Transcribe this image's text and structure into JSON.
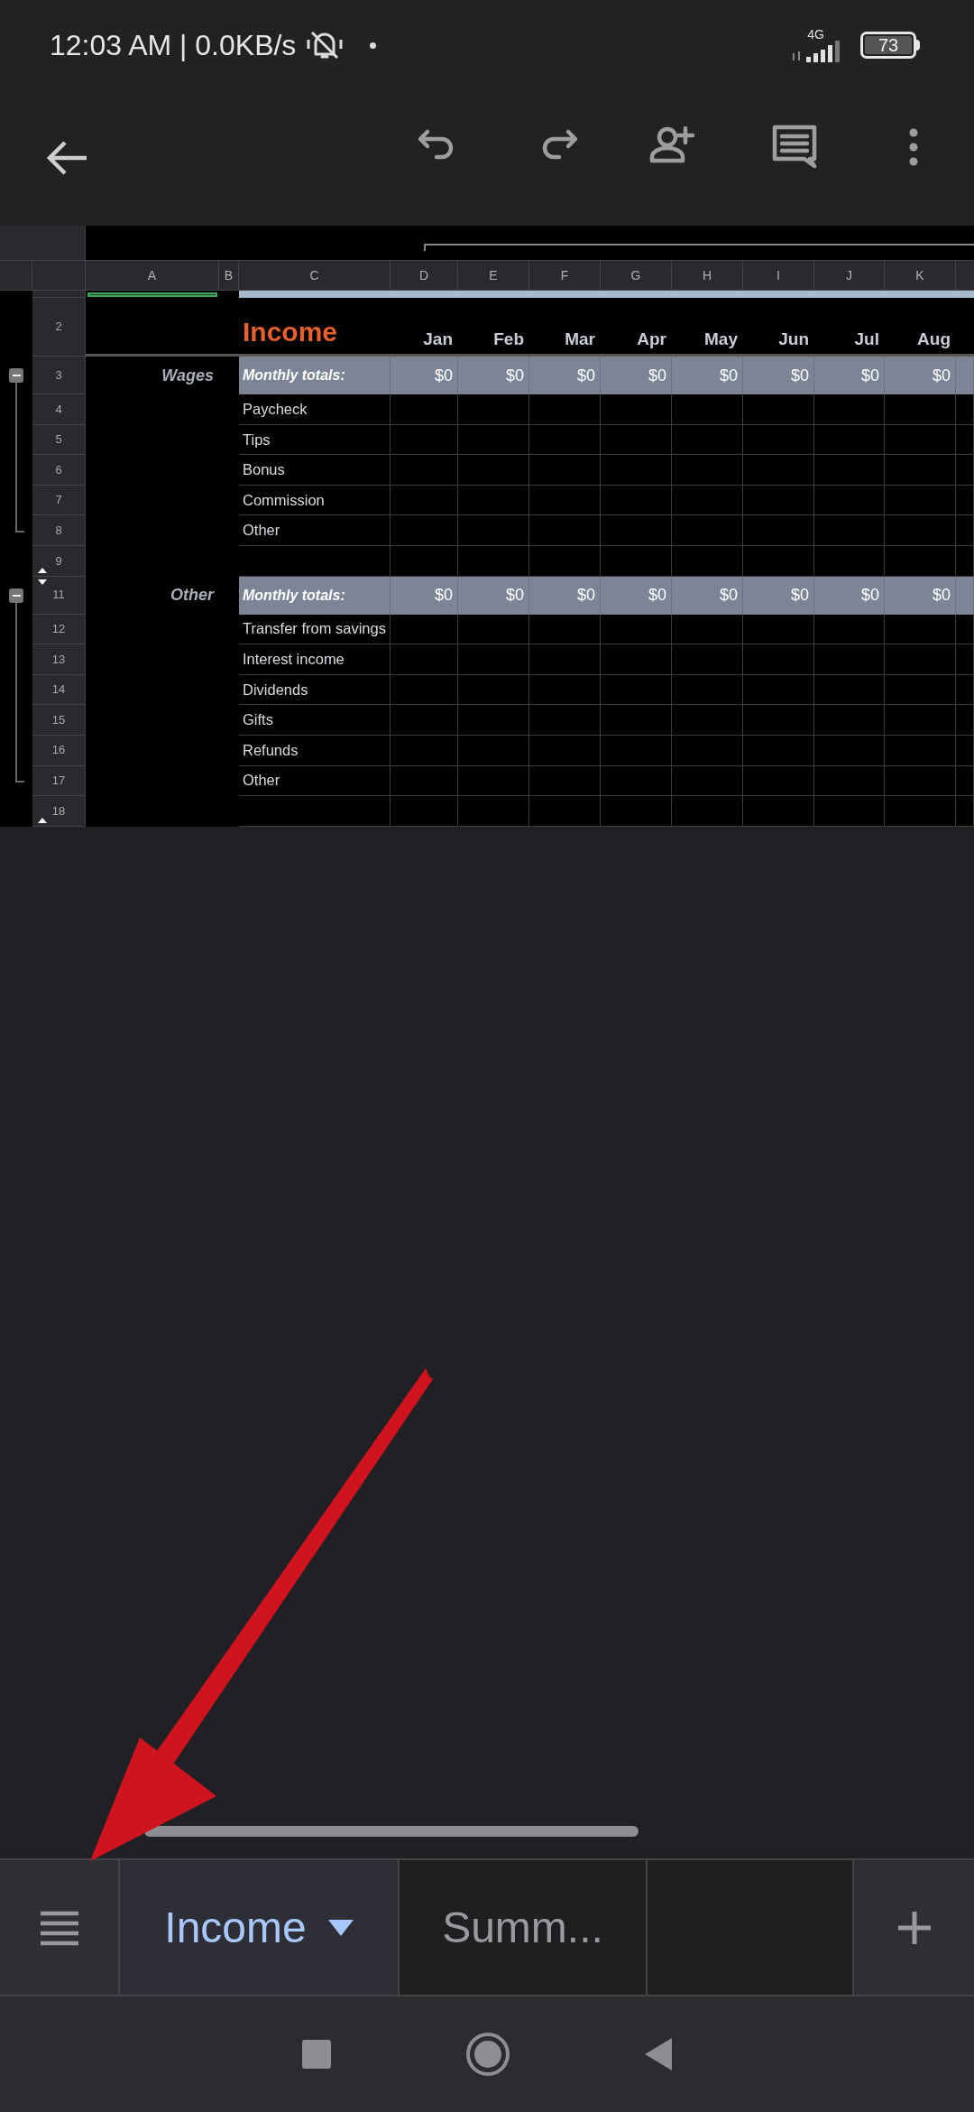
{
  "status_bar": {
    "time": "12:03 AM | 0.0KB/s",
    "network": "4G",
    "battery": "73"
  },
  "sheet": {
    "columns": [
      "A",
      "B",
      "C",
      "D",
      "E",
      "F",
      "G",
      "H",
      "I",
      "J",
      "K"
    ],
    "rows": [
      {
        "kind": "spacer"
      },
      {
        "number": "2",
        "kind": "title",
        "title": "Income",
        "months": [
          "Jan",
          "Feb",
          "Mar",
          "Apr",
          "May",
          "Jun",
          "Jul",
          "Aug"
        ]
      },
      {
        "number": "3",
        "kind": "total",
        "group": "Wages",
        "label": "Monthly totals:",
        "values": [
          "$0",
          "$0",
          "$0",
          "$0",
          "$0",
          "$0",
          "$0",
          "$0"
        ],
        "outline_expanded": true
      },
      {
        "number": "4",
        "kind": "item",
        "label": "Paycheck"
      },
      {
        "number": "5",
        "kind": "item",
        "label": "Tips"
      },
      {
        "number": "6",
        "kind": "item",
        "label": "Bonus"
      },
      {
        "number": "7",
        "kind": "item",
        "label": "Commission"
      },
      {
        "number": "8",
        "kind": "item",
        "label": "Other"
      },
      {
        "number": "9",
        "kind": "item",
        "hidden_below": true
      },
      {
        "number": "11",
        "kind": "total",
        "group": "Other",
        "label": "Monthly totals:",
        "values": [
          "$0",
          "$0",
          "$0",
          "$0",
          "$0",
          "$0",
          "$0",
          "$0"
        ],
        "outline_expanded": true,
        "hidden_above": true
      },
      {
        "number": "12",
        "kind": "item",
        "label": "Transfer from savings"
      },
      {
        "number": "13",
        "kind": "item",
        "label": "Interest income"
      },
      {
        "number": "14",
        "kind": "item",
        "label": "Dividends"
      },
      {
        "number": "15",
        "kind": "item",
        "label": "Gifts"
      },
      {
        "number": "16",
        "kind": "item",
        "label": "Refunds"
      },
      {
        "number": "17",
        "kind": "item",
        "label": "Other"
      },
      {
        "number": "18",
        "kind": "item",
        "hidden_below": true
      }
    ]
  },
  "sheet_tabs": [
    {
      "label": "Income",
      "selected": true
    },
    {
      "label": "Summ...",
      "selected": false
    }
  ]
}
